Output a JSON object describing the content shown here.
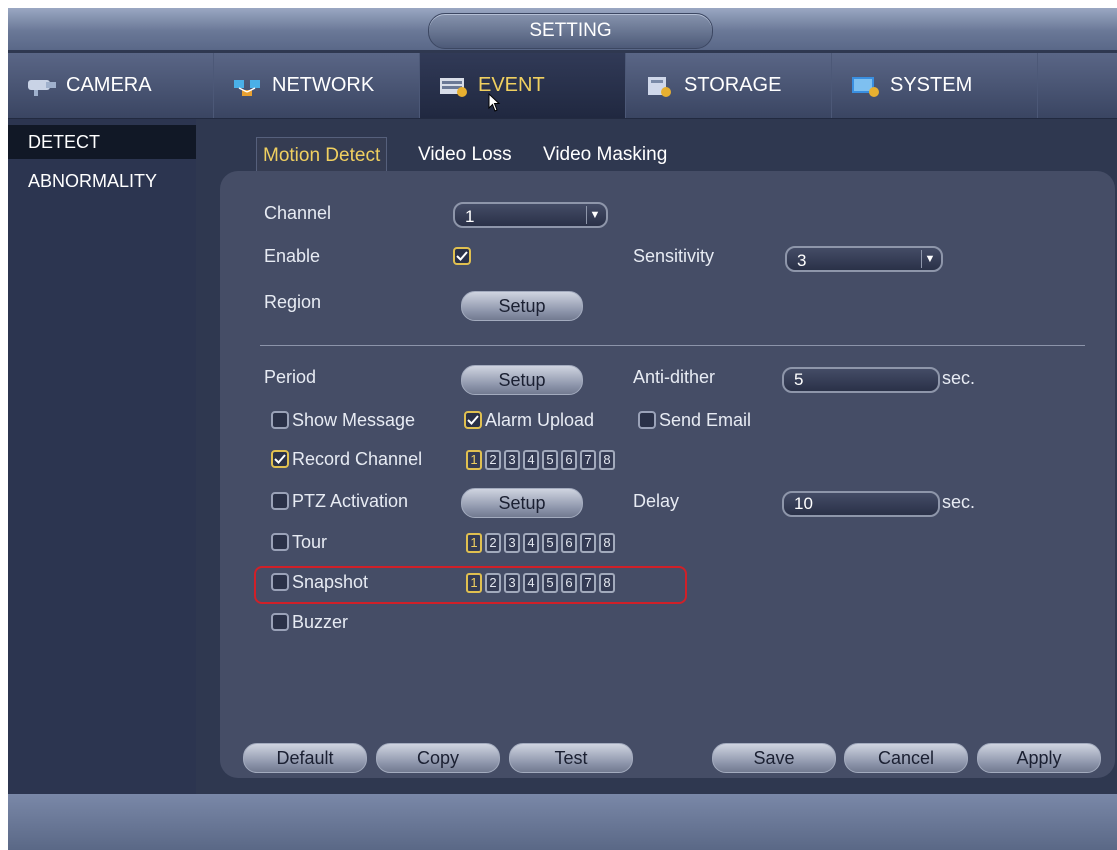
{
  "window": {
    "title": "SETTING"
  },
  "tabs": [
    {
      "label": "CAMERA",
      "icon": "camera-icon",
      "active": false
    },
    {
      "label": "NETWORK",
      "icon": "network-icon",
      "active": false
    },
    {
      "label": "EVENT",
      "icon": "event-icon",
      "active": true
    },
    {
      "label": "STORAGE",
      "icon": "storage-icon",
      "active": false
    },
    {
      "label": "SYSTEM",
      "icon": "system-icon",
      "active": false
    }
  ],
  "sidebar": {
    "items": [
      {
        "label": "DETECT",
        "active": true
      },
      {
        "label": "ABNORMALITY",
        "active": false
      }
    ]
  },
  "subtabs": [
    {
      "label": "Motion Detect",
      "active": true
    },
    {
      "label": "Video Loss",
      "active": false
    },
    {
      "label": "Video Masking",
      "active": false
    }
  ],
  "form": {
    "channel_label": "Channel",
    "channel_value": "1",
    "enable_label": "Enable",
    "enable_checked": true,
    "sensitivity_label": "Sensitivity",
    "sensitivity_value": "3",
    "region_label": "Region",
    "setup_label": "Setup",
    "period_label": "Period",
    "anti_dither_label": "Anti-dither",
    "anti_dither_value": "5",
    "sec_label": "sec.",
    "show_message_label": "Show Message",
    "show_message_checked": false,
    "alarm_upload_label": "Alarm Upload",
    "alarm_upload_checked": true,
    "send_email_label": "Send Email",
    "send_email_checked": false,
    "record_channel_label": "Record Channel",
    "record_channel_checked": true,
    "ptz_activation_label": "PTZ Activation",
    "ptz_activation_checked": false,
    "delay_label": "Delay",
    "delay_value": "10",
    "tour_label": "Tour",
    "tour_checked": false,
    "snapshot_label": "Snapshot",
    "snapshot_checked": false,
    "buzzer_label": "Buzzer",
    "buzzer_checked": false,
    "channels": [
      "1",
      "2",
      "3",
      "4",
      "5",
      "6",
      "7",
      "8"
    ],
    "selected_channel": "1"
  },
  "buttons": {
    "default": "Default",
    "copy": "Copy",
    "test": "Test",
    "save": "Save",
    "cancel": "Cancel",
    "apply": "Apply"
  },
  "colors": {
    "active_text": "#f0d060",
    "highlight_outline": "#d02028"
  }
}
